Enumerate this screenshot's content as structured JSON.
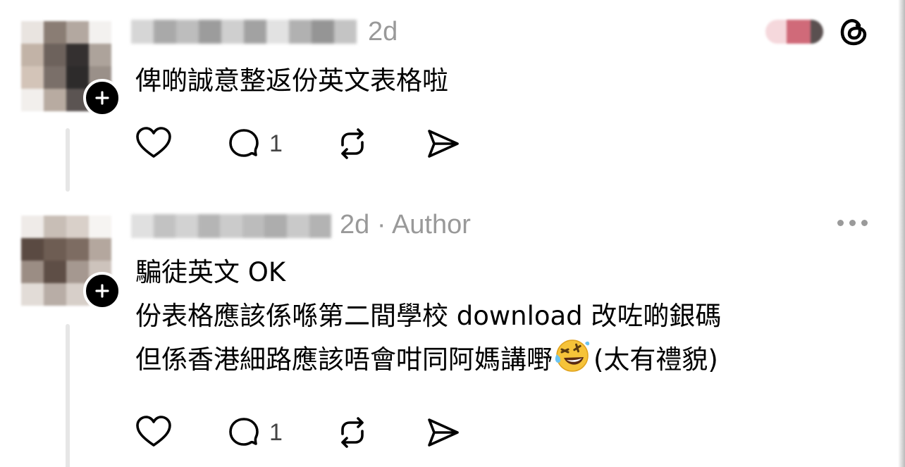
{
  "header": {
    "logo_icon": "threads-logo-icon"
  },
  "replies": [
    {
      "username": "",
      "meta": "2d",
      "lines": [
        "俾啲誠意整返份英文表格啦"
      ],
      "actions": {
        "like_icon": "heart-icon",
        "comment_icon": "comment-icon",
        "comment_count": "1",
        "repost_icon": "repost-icon",
        "share_icon": "send-icon"
      }
    },
    {
      "username": "",
      "meta": "2d · Author",
      "lines": [
        "騙徒英文 OK",
        "份表格應該係喺第二間學校 download 改咗啲銀碼",
        "但係香港細路應該唔會咁同阿媽講嘢",
        "(太有禮貌)"
      ],
      "emoji_icon": "rolling-on-floor-laughing-emoji",
      "actions": {
        "like_icon": "heart-icon",
        "comment_icon": "comment-icon",
        "comment_count": "1",
        "repost_icon": "repost-icon",
        "share_icon": "send-icon"
      },
      "more_icon": "more-options-icon"
    }
  ]
}
